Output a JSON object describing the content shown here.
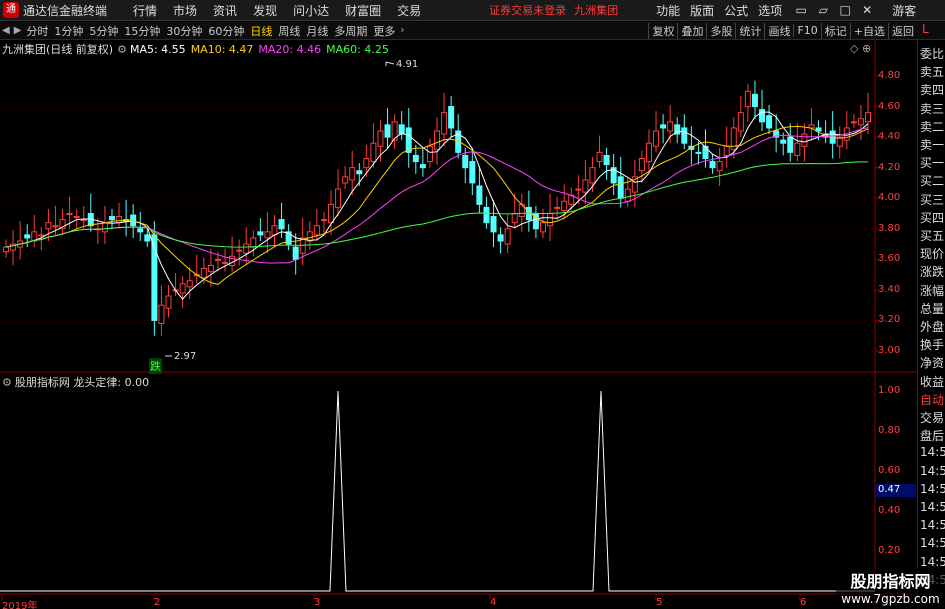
{
  "titlebar": {
    "app_name": "通达信金融终端",
    "menus": [
      "行情",
      "市场",
      "资讯",
      "发现",
      "问小达",
      "财富圈",
      "交易"
    ],
    "warning": "证券交易未登录",
    "company": "九洲集团",
    "right_menus": [
      "功能",
      "版面",
      "公式",
      "选项"
    ],
    "guest": "游客"
  },
  "periodbar": {
    "periods": [
      "分时",
      "1分钟",
      "5分钟",
      "15分钟",
      "30分钟",
      "60分钟",
      "日线",
      "周线",
      "月线",
      "多周期",
      "更多"
    ],
    "active_period": "日线",
    "right_buttons": [
      "复权",
      "叠加",
      "多股",
      "统计",
      "画线",
      "F10",
      "标记",
      "+自选",
      "返回"
    ]
  },
  "main": {
    "stock_title": "九洲集团(日线 前复权)",
    "ma5": "MA5: 4.55",
    "ma10": "MA10: 4.47",
    "ma20": "MA20: 4.46",
    "ma60": "MA60: 4.25",
    "high_label": "4.91",
    "low_label": "2.97",
    "low_mark": "跌",
    "price_scale": [
      "4.80",
      "4.60",
      "4.40",
      "4.20",
      "4.00",
      "3.80",
      "3.60",
      "3.40",
      "3.20",
      "3.00"
    ]
  },
  "sub": {
    "title": "股朋指标网 龙头定律: 0.00",
    "scale": [
      "1.00",
      "0.80",
      "0.60",
      "0.40",
      "0.20"
    ],
    "current_value": "0.47"
  },
  "xaxis": [
    "2019年",
    "2",
    "3",
    "4",
    "5",
    "6"
  ],
  "rightpanel": {
    "top_label": "L",
    "labels": [
      "委比",
      "卖五",
      "卖四",
      "卖三",
      "卖二",
      "卖一",
      "买一",
      "买二",
      "买三",
      "买四",
      "买五",
      "现价",
      "涨跌",
      "涨幅",
      "总量",
      "外盘",
      "换手",
      "净资",
      "收益",
      "自动",
      "交易",
      "盘后",
      "14:56",
      "14:56",
      "14:56",
      "14:56",
      "14:56",
      "14:56",
      "14:56",
      "14:56"
    ]
  },
  "watermark": {
    "line1": "股朋指标网",
    "line2": "www.7gpzb.com"
  },
  "colors": {
    "up": "#ff3b3b",
    "down": "#54ffff",
    "ma5": "#ffffff",
    "ma10": "#ffd000",
    "ma20": "#ff40ff",
    "ma60": "#40ff40",
    "accent_red": "#8b0000"
  }
}
